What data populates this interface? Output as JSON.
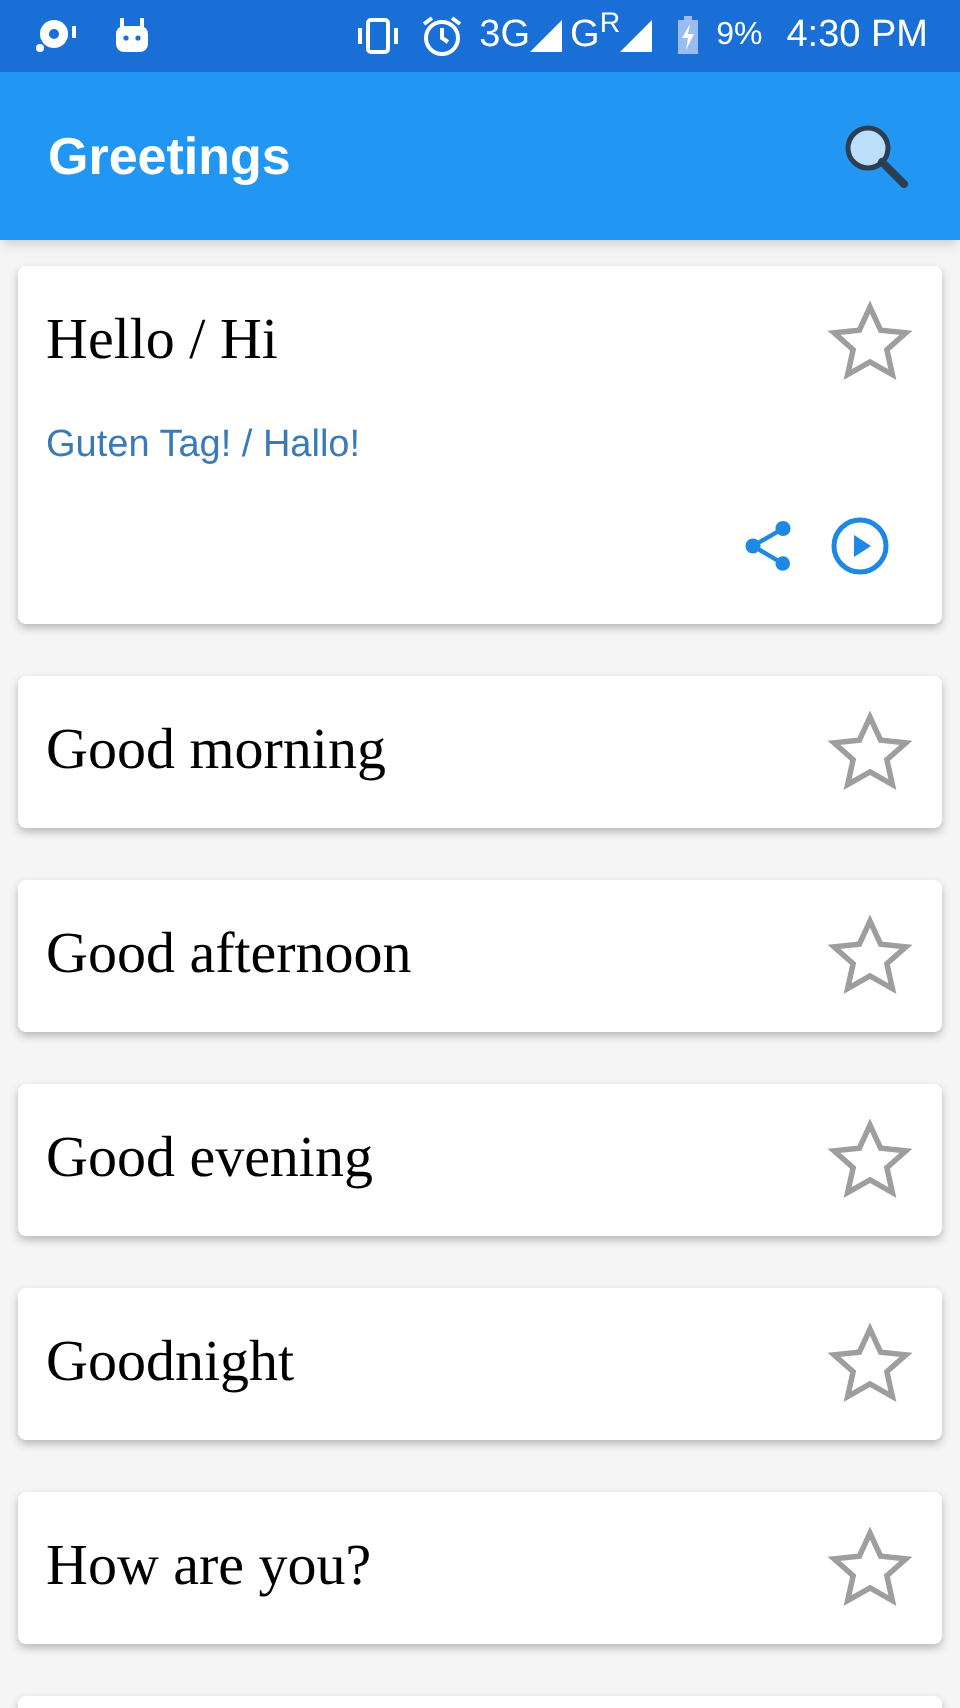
{
  "status_bar": {
    "network": "3G",
    "carrier": "G$^{R}$",
    "battery": "9%",
    "time": "4:30 PM"
  },
  "app_bar": {
    "title": "Greetings"
  },
  "phrases": [
    {
      "text": "Hello / Hi",
      "favorite": false,
      "expanded": true,
      "translation": "Guten Tag! / Hallo!"
    },
    {
      "text": "Good morning",
      "favorite": false,
      "expanded": false
    },
    {
      "text": "Good afternoon",
      "favorite": false,
      "expanded": false
    },
    {
      "text": "Good evening",
      "favorite": false,
      "expanded": false
    },
    {
      "text": "Goodnight",
      "favorite": false,
      "expanded": false
    },
    {
      "text": "How are you?",
      "favorite": false,
      "expanded": false
    }
  ]
}
